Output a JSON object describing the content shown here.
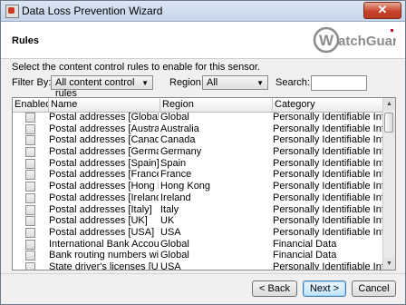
{
  "window": {
    "title": "Data Loss Prevention Wizard",
    "close_glyph": "✕"
  },
  "header": {
    "page_title": "Rules",
    "logo_text": "WatchGuard"
  },
  "instruction": "Select the content control rules to enable for this sensor.",
  "filter": {
    "label": "Filter By:",
    "value": "All content control rules"
  },
  "region": {
    "label": "Region:",
    "value": "All"
  },
  "search": {
    "label": "Search:",
    "value": ""
  },
  "grid": {
    "columns": [
      "Enabled",
      "Name",
      "Region",
      "Category"
    ],
    "rows": [
      {
        "enabled": false,
        "name": "Postal addresses [Global]",
        "region": "Global",
        "category": "Personally Identifiable Informa..."
      },
      {
        "enabled": false,
        "name": "Postal addresses [Australia]",
        "region": "Australia",
        "category": "Personally Identifiable Informa..."
      },
      {
        "enabled": false,
        "name": "Postal addresses [Canada]",
        "region": "Canada",
        "category": "Personally Identifiable Informa..."
      },
      {
        "enabled": false,
        "name": "Postal addresses [Germany]",
        "region": "Germany",
        "category": "Personally Identifiable Informa..."
      },
      {
        "enabled": false,
        "name": "Postal addresses [Spain]",
        "region": "Spain",
        "category": "Personally Identifiable Informa..."
      },
      {
        "enabled": false,
        "name": "Postal addresses [France]",
        "region": "France",
        "category": "Personally Identifiable Informa..."
      },
      {
        "enabled": false,
        "name": "Postal addresses [Hong Kong]",
        "region": "Hong Kong",
        "category": "Personally Identifiable Informa..."
      },
      {
        "enabled": false,
        "name": "Postal addresses [Ireland]",
        "region": "Ireland",
        "category": "Personally Identifiable Informa..."
      },
      {
        "enabled": false,
        "name": "Postal addresses [Italy]",
        "region": "Italy",
        "category": "Personally Identifiable Informa..."
      },
      {
        "enabled": false,
        "name": "Postal addresses [UK]",
        "region": "UK",
        "category": "Personally Identifiable Informa..."
      },
      {
        "enabled": false,
        "name": "Postal addresses [USA]",
        "region": "USA",
        "category": "Personally Identifiable Informa..."
      },
      {
        "enabled": false,
        "name": "International Bank Account N...",
        "region": "Global",
        "category": "Financial Data"
      },
      {
        "enabled": false,
        "name": "Bank routing numbers with qu...",
        "region": "Global",
        "category": "Financial Data"
      },
      {
        "enabled": false,
        "name": "State driver's licenses [USA]",
        "region": "USA",
        "category": "Personally Identifiable Informa..."
      }
    ]
  },
  "buttons": {
    "back": "< Back",
    "next": "Next >",
    "cancel": "Cancel"
  },
  "colors": {
    "logo_gray": "#8c8c8c",
    "logo_red": "#c8102e",
    "title_close": "#c7442a"
  }
}
